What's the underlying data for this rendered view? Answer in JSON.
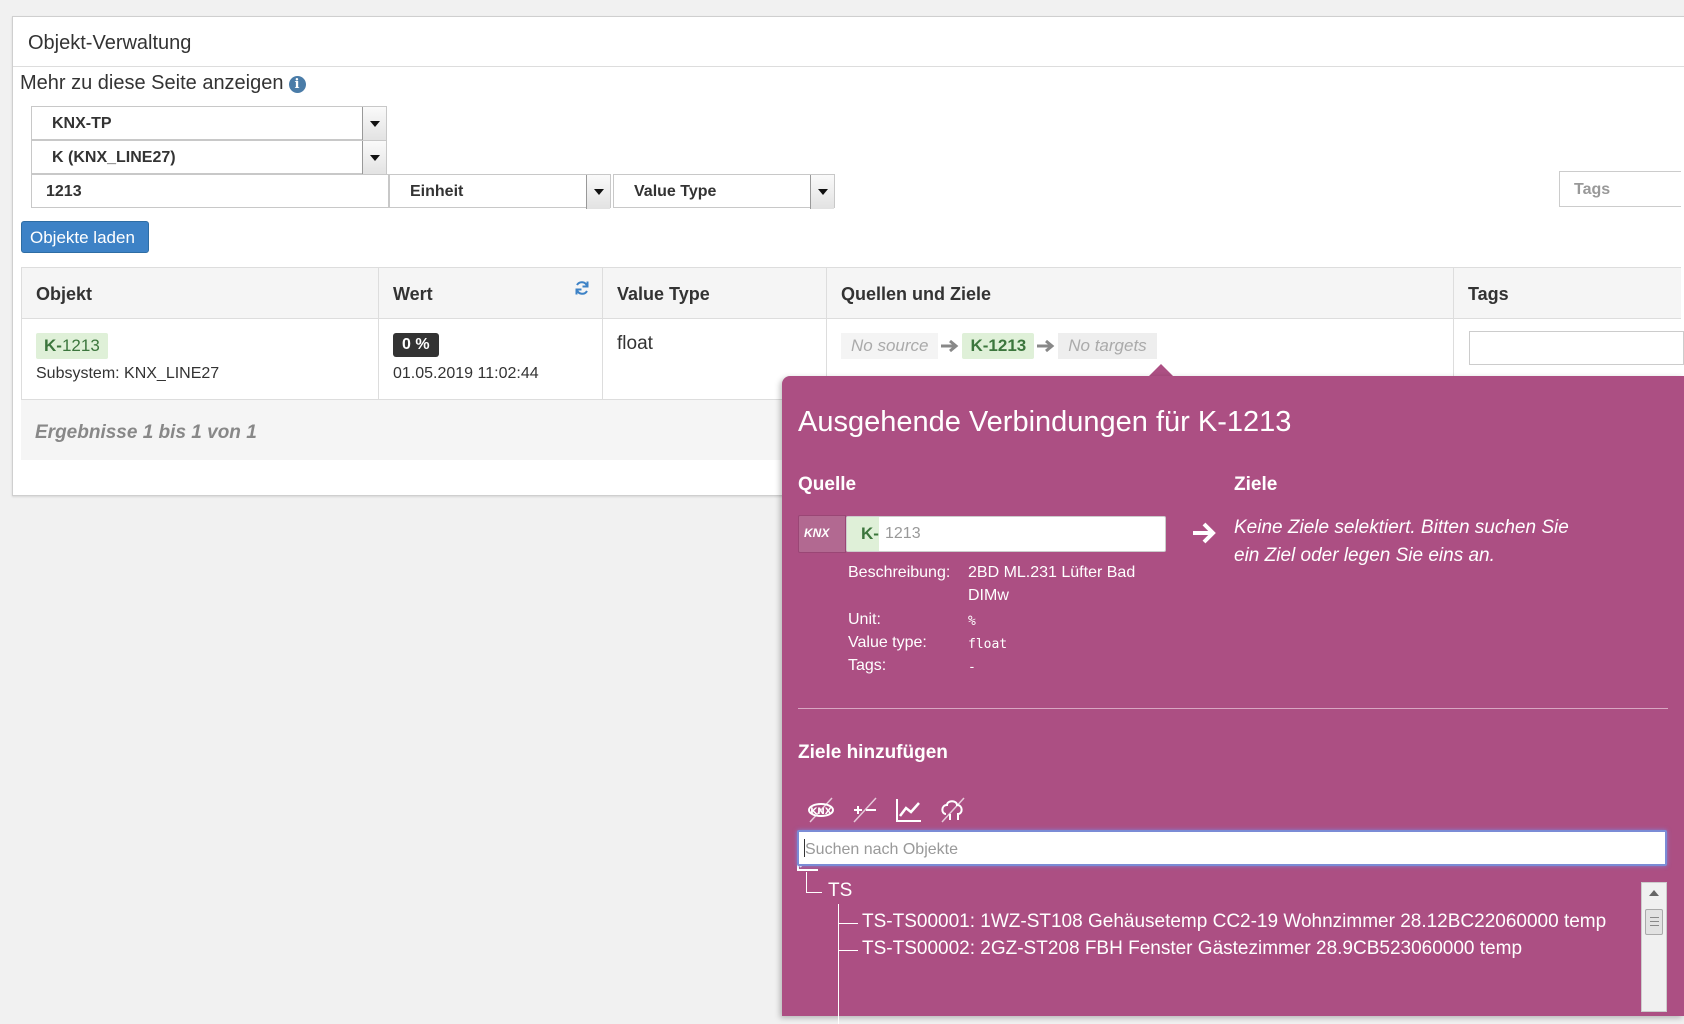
{
  "panel": {
    "title": "Objekt-Verwaltung",
    "more_label": "Mehr zu diese Seite anzeigen",
    "info_glyph": "i"
  },
  "filters": {
    "subsystem_type": "KNX-TP",
    "subsystem": "K (KNX_LINE27)",
    "search_value": "1213",
    "unit_placeholder": "Einheit",
    "value_type_placeholder": "Value Type",
    "tags_placeholder": "Tags"
  },
  "load_button": "Objekte laden",
  "table": {
    "headers": [
      "Objekt",
      "Wert",
      "Value Type",
      "Quellen und Ziele",
      "Tags"
    ],
    "row": {
      "object_prefix": "K-",
      "object_id": "1213",
      "subsystem_label": "Subsystem: KNX_LINE27",
      "value_badge": "0 %",
      "timestamp": "01.05.2019 11:02:44",
      "value_type": "float",
      "no_source": "No source",
      "object_badge": "K-1213",
      "no_targets": "No targets"
    },
    "footer": "Ergebnisse 1 bis 1 von 1"
  },
  "popover": {
    "title": "Ausgehende Verbindungen für K-1213",
    "source_heading": "Quelle",
    "targets_heading": "Ziele",
    "source_prefix": "K-",
    "source_value": "1213",
    "knx_icon_text": "KNX",
    "details": {
      "desc_key": "Beschreibung:",
      "desc_value_1": "2BD ML.231 Lüfter Bad",
      "desc_value_2": "DIMw",
      "unit_key": "Unit:",
      "unit_value": "%",
      "vtype_key": "Value type:",
      "vtype_value": "float",
      "tags_key": "Tags:",
      "tags_value": "-"
    },
    "no_targets_msg_1": "Keine Ziele selektiert. Bitten suchen Sie",
    "no_targets_msg_2": "ein Ziel oder legen Sie eins an.",
    "add_targets_heading": "Ziele hinzufügen",
    "search_placeholder": "Suchen nach Objekte",
    "tree": {
      "group": "TS",
      "items": [
        "TS-TS00001: 1WZ-ST108 Gehäusetemp CC2-19 Wohnzimmer 28.12BC22060000 temp",
        "TS-TS00002: 2GZ-ST208 FBH Fenster Gästezimmer 28.9CB523060000 temp"
      ]
    },
    "colors": {
      "background": "#ac4f83",
      "accent_blue": "#3d82c6",
      "badge_green_bg": "#dff0d8",
      "badge_green_text": "#3c763d"
    }
  }
}
